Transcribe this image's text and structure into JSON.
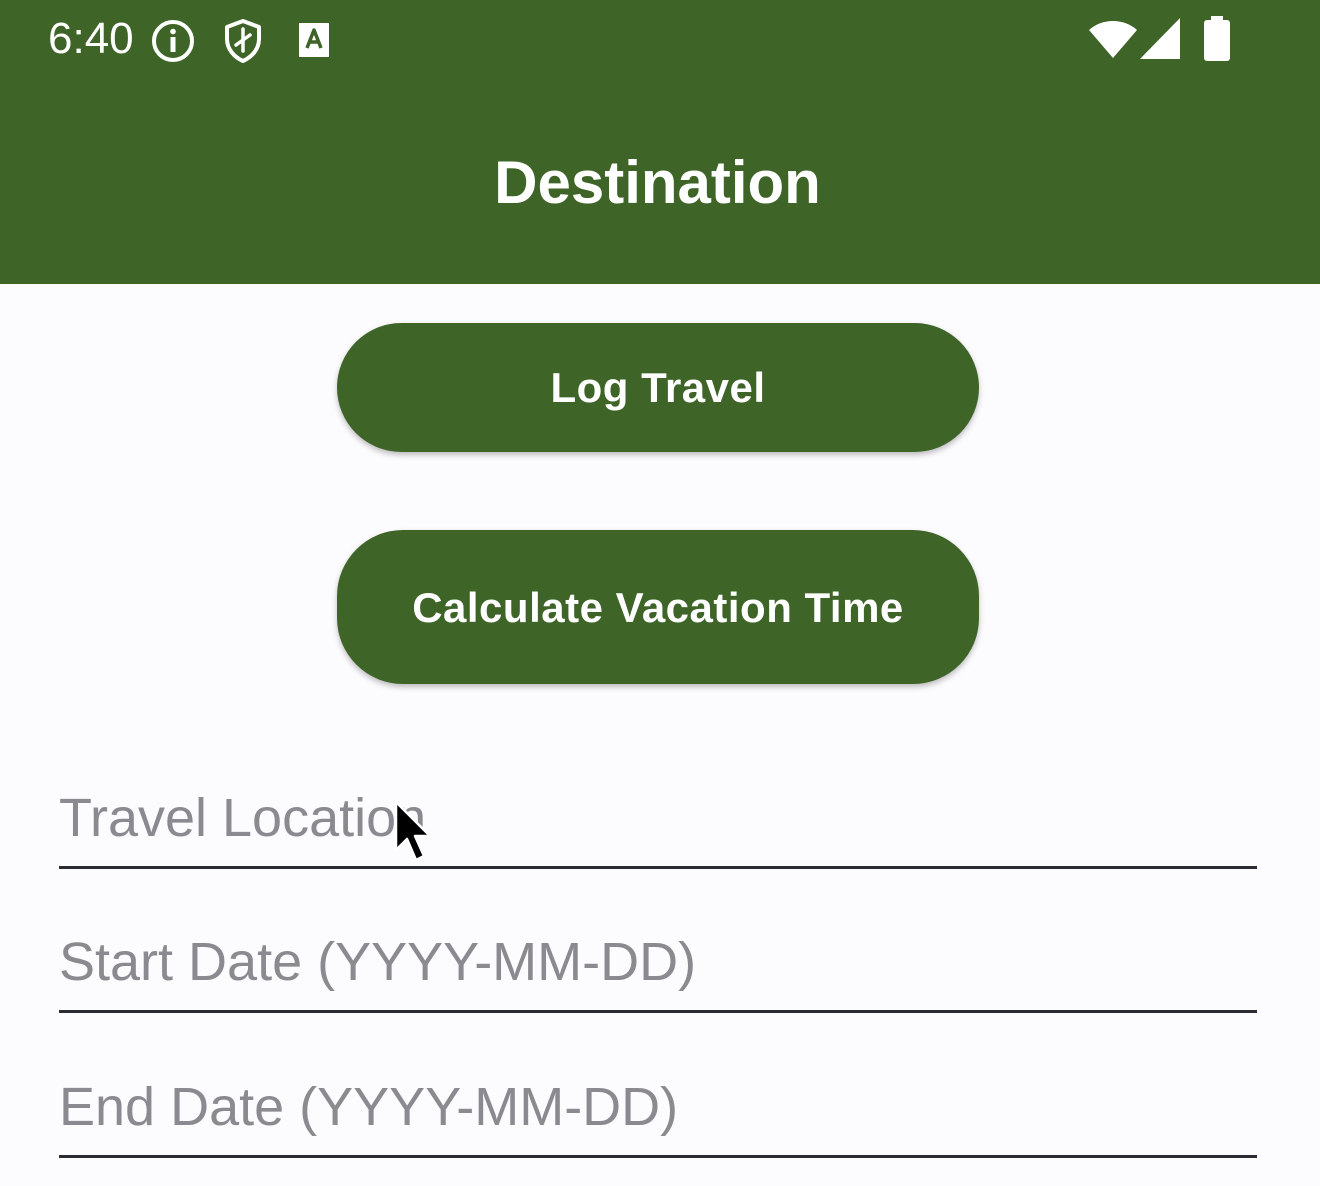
{
  "status_bar": {
    "time": "6:40",
    "left_icons": [
      "info-icon",
      "shield-icon",
      "a-box-icon"
    ],
    "right_icons": [
      "wifi-icon",
      "cellular-signal-icon",
      "battery-icon"
    ]
  },
  "app_bar": {
    "title": "Destination",
    "color": "#3e6427"
  },
  "buttons": {
    "log_travel": "Log Travel",
    "calculate_vacation_time": "Calculate Vacation Time"
  },
  "fields": {
    "travel_location": {
      "value": "",
      "placeholder": "Travel Location"
    },
    "start_date": {
      "value": "",
      "placeholder": "Start Date (YYYY-MM-DD)"
    },
    "end_date": {
      "value": "",
      "placeholder": "End Date (YYYY-MM-DD)"
    }
  },
  "colors": {
    "primary": "#3e6427",
    "background": "#fcfbfe",
    "on_primary": "#ffffff",
    "hint": "#8a8a90"
  }
}
